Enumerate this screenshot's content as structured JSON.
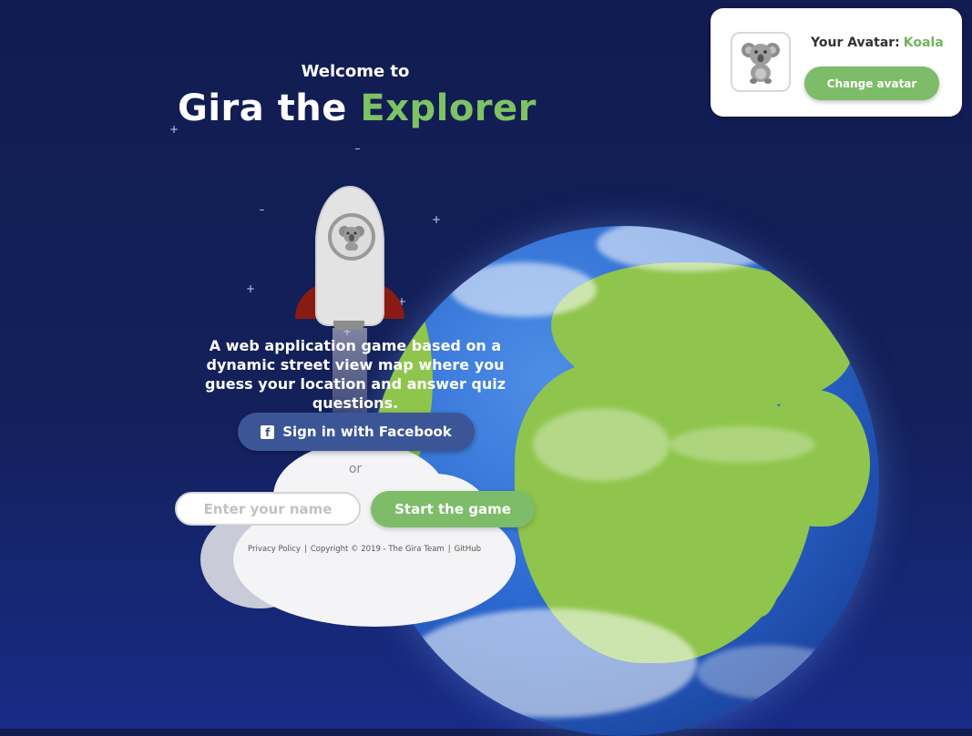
{
  "header": {
    "welcome": "Welcome to",
    "title_main": "Gira the ",
    "title_accent": "Explorer"
  },
  "description": "A web application game based on a dynamic street view map where you guess your location and answer quiz questions.",
  "login": {
    "facebook_label": "Sign in with Facebook",
    "facebook_icon": "facebook-icon",
    "or_text": "or",
    "name_placeholder": "Enter your name",
    "start_label": "Start the game"
  },
  "footer": {
    "privacy": "Privacy Policy",
    "copyright": "Copyright © 2019 - The Gira Team",
    "github": "GitHub"
  },
  "avatar": {
    "label": "Your Avatar:",
    "name": "Koala",
    "icon": "koala-icon",
    "change_label": "Change avatar"
  },
  "colors": {
    "background": "#121c52",
    "accent_green": "#7dbc68",
    "facebook_blue": "#3b5597",
    "rocket_fin": "#8a1b12"
  }
}
